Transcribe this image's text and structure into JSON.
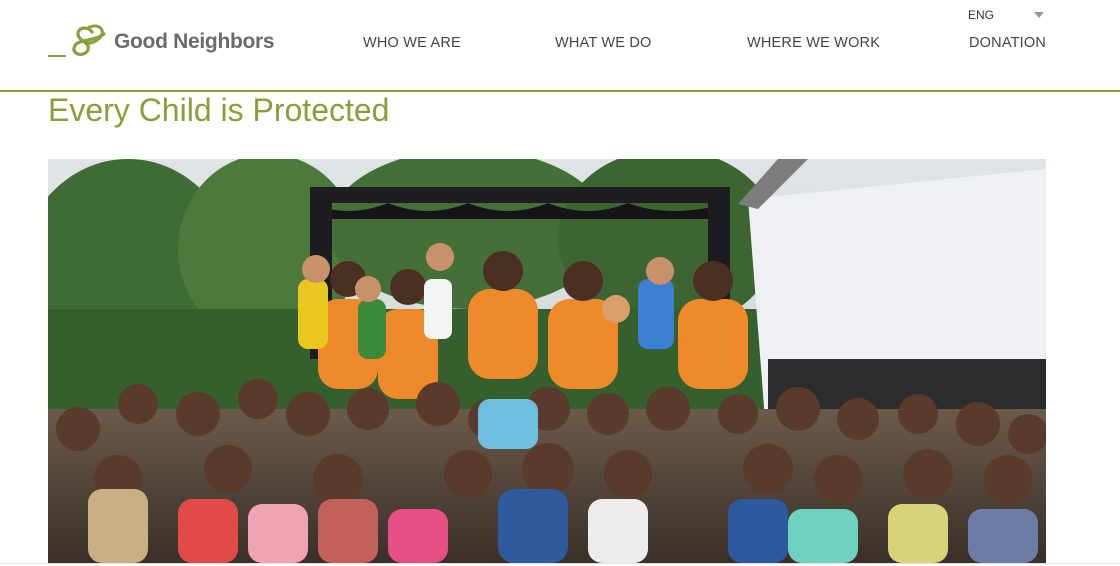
{
  "brand": {
    "name": "Good Neighbors",
    "color": "#86a03a"
  },
  "language": {
    "selected": "ENG"
  },
  "nav": {
    "who_we_are": "WHO WE ARE",
    "what_we_do": "WHAT WE DO",
    "where_we_work": "WHERE WE WORK",
    "donation": "DONATION"
  },
  "page": {
    "title": "Every Child is Protected"
  },
  "icons": {
    "language_dropdown": "chevron-down-icon",
    "logo_mark": "good-neighbors-logo"
  },
  "colors": {
    "title_green": "#86a03a",
    "divider": "#8a9a3c",
    "nav_text": "#444444"
  }
}
